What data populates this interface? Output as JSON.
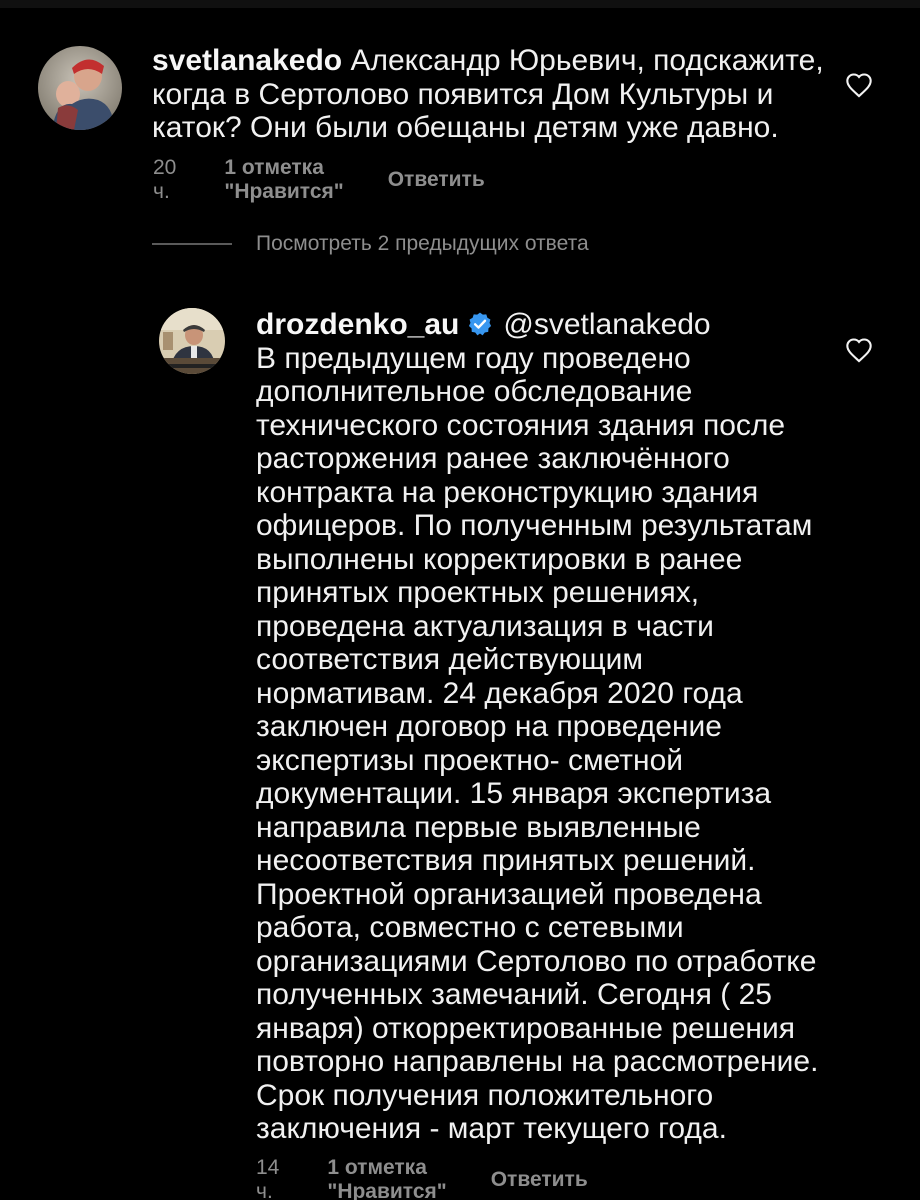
{
  "comment1": {
    "username": "svetlanakedo",
    "text_lines": [
      "Александр Юрьевич, подскажите,",
      "когда в Сертолово появится Дом Культуры и",
      "каток? Они были обещаны детям уже давно."
    ],
    "time": "20 ч.",
    "likes": "1 отметка \"Нравится\"",
    "reply": "Ответить",
    "avatar_icon": "user-photo-avatar",
    "like_icon": "heart-outline-icon"
  },
  "view_replies": {
    "label": "Посмотреть 2 предыдущих ответа"
  },
  "comment2": {
    "username": "drozdenko_au",
    "verified_icon": "verified-badge-icon",
    "mention": "@svetlanakedo",
    "body_lines": [
      "В предыдущем году проведено",
      "дополнительное обследование",
      "технического состояния здания после",
      "расторжения ранее заключённого",
      "контракта на реконструкцию здания",
      "офицеров. По полученным результатам",
      "выполнены корректировки в ранее",
      "принятых проектных решениях,",
      "проведена актуализация в части",
      "соответствия действующим",
      "нормативам. 24 декабря 2020 года",
      "заключен договор на проведение",
      "экспертизы проектно- сметной",
      "документации. 15 января экспертиза",
      "направила первые выявленные",
      "несоответствия принятых решений.",
      "Проектной организацией проведена",
      "работа, совместно с сетевыми",
      "организациями Сертолово по отработке",
      "полученных замечаний. Сегодня ( 25",
      "января) откорректированные решения",
      "повторно направлены на рассмотрение.",
      "Срок получения положительного",
      "заключения - март текущего года."
    ],
    "time": "14 ч.",
    "likes": "1 отметка \"Нравится\"",
    "reply": "Ответить",
    "avatar_icon": "official-photo-avatar",
    "like_icon": "heart-outline-icon"
  },
  "colors": {
    "background": "#000000",
    "text": "#f1f1f1",
    "muted": "#8e8e8e",
    "verified": "#3897f0"
  }
}
